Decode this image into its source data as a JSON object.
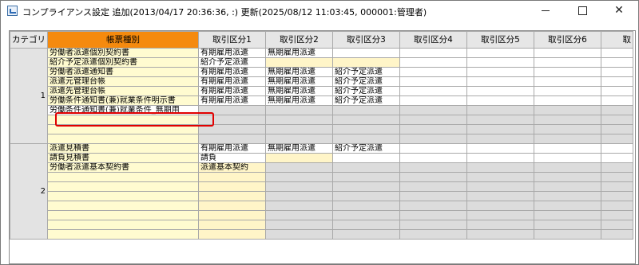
{
  "window": {
    "title": "コンプライアンス設定 追加(2013/04/17 20:36:36, :) 更新(2025/08/12 11:03:45, 000001:管理者)"
  },
  "table": {
    "headers": [
      "カテゴリ",
      "帳票種別",
      "取引区分1",
      "取引区分2",
      "取引区分3",
      "取引区分4",
      "取引区分5",
      "取引区分6",
      "取"
    ],
    "groups": [
      {
        "category": "1",
        "rows": [
          {
            "name": "労働者派遣個別契約書",
            "vals": [
              "有期雇用派遣",
              "無期雇用派遣",
              "",
              "",
              "",
              ""
            ]
          },
          {
            "name": "紹介予定派遣個別契約書",
            "vals": [
              "紹介予定派遣",
              "",
              "",
              "",
              "",
              ""
            ]
          },
          {
            "name": "労働者派遣通知書",
            "vals": [
              "有期雇用派遣",
              "無期雇用派遣",
              "紹介予定派遣",
              "",
              "",
              ""
            ]
          },
          {
            "name": "派遣元管理台帳",
            "vals": [
              "有期雇用派遣",
              "無期雇用派遣",
              "紹介予定派遣",
              "",
              "",
              ""
            ]
          },
          {
            "name": "派遣先管理台帳",
            "vals": [
              "有期雇用派遣",
              "無期雇用派遣",
              "紹介予定派遣",
              "",
              "",
              ""
            ]
          },
          {
            "name": "労働条件通知書(兼)就業条件明示書",
            "vals": [
              "有期雇用派遣",
              "無期雇用派遣",
              "紹介予定派遣",
              "",
              "",
              ""
            ]
          },
          {
            "name": "労働条件通知書(兼)就業条件_無期用",
            "vals": [
              "",
              "",
              "",
              "",
              "",
              ""
            ]
          },
          {
            "name": "",
            "vals": [
              "",
              "",
              "",
              "",
              "",
              ""
            ]
          },
          {
            "name": "",
            "vals": [
              "",
              "",
              "",
              "",
              "",
              ""
            ]
          },
          {
            "name": "",
            "vals": [
              "",
              "",
              "",
              "",
              "",
              ""
            ]
          }
        ]
      },
      {
        "category": "2",
        "rows": [
          {
            "name": "派遣見積書",
            "vals": [
              "有期雇用派遣",
              "無期雇用派遣",
              "紹介予定派遣",
              "",
              "",
              ""
            ]
          },
          {
            "name": "請負見積書",
            "vals": [
              "請負",
              "",
              "",
              "",
              "",
              ""
            ]
          },
          {
            "name": "労働者派遣基本契約書",
            "vals": [
              "派遣基本契約",
              "",
              "",
              "",
              "",
              ""
            ]
          },
          {
            "name": "",
            "vals": [
              "",
              "",
              "",
              "",
              "",
              ""
            ]
          },
          {
            "name": "",
            "vals": [
              "",
              "",
              "",
              "",
              "",
              ""
            ]
          },
          {
            "name": "",
            "vals": [
              "",
              "",
              "",
              "",
              "",
              ""
            ]
          },
          {
            "name": "",
            "vals": [
              "",
              "",
              "",
              "",
              "",
              ""
            ]
          },
          {
            "name": "",
            "vals": [
              "",
              "",
              "",
              "",
              "",
              ""
            ]
          },
          {
            "name": "",
            "vals": [
              "",
              "",
              "",
              "",
              "",
              ""
            ]
          },
          {
            "name": "",
            "vals": [
              "",
              "",
              "",
              "",
              "",
              ""
            ]
          }
        ]
      }
    ]
  },
  "colors": {
    "header_accent": "#f58a0e",
    "highlight_border": "#e10000",
    "form_cell_bg": "#fffbd0",
    "category_bg": "#e3e3e3"
  }
}
